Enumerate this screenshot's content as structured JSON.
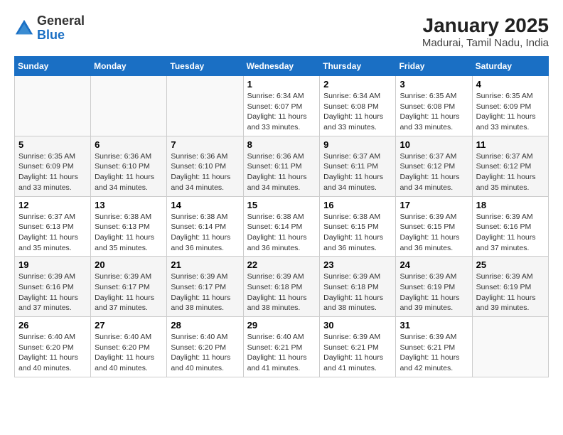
{
  "header": {
    "logo_general": "General",
    "logo_blue": "Blue",
    "title": "January 2025",
    "subtitle": "Madurai, Tamil Nadu, India"
  },
  "calendar": {
    "days_of_week": [
      "Sunday",
      "Monday",
      "Tuesday",
      "Wednesday",
      "Thursday",
      "Friday",
      "Saturday"
    ],
    "weeks": [
      [
        {
          "day": "",
          "info": ""
        },
        {
          "day": "",
          "info": ""
        },
        {
          "day": "",
          "info": ""
        },
        {
          "day": "1",
          "info": "Sunrise: 6:34 AM\nSunset: 6:07 PM\nDaylight: 11 hours\nand 33 minutes."
        },
        {
          "day": "2",
          "info": "Sunrise: 6:34 AM\nSunset: 6:08 PM\nDaylight: 11 hours\nand 33 minutes."
        },
        {
          "day": "3",
          "info": "Sunrise: 6:35 AM\nSunset: 6:08 PM\nDaylight: 11 hours\nand 33 minutes."
        },
        {
          "day": "4",
          "info": "Sunrise: 6:35 AM\nSunset: 6:09 PM\nDaylight: 11 hours\nand 33 minutes."
        }
      ],
      [
        {
          "day": "5",
          "info": "Sunrise: 6:35 AM\nSunset: 6:09 PM\nDaylight: 11 hours\nand 33 minutes."
        },
        {
          "day": "6",
          "info": "Sunrise: 6:36 AM\nSunset: 6:10 PM\nDaylight: 11 hours\nand 34 minutes."
        },
        {
          "day": "7",
          "info": "Sunrise: 6:36 AM\nSunset: 6:10 PM\nDaylight: 11 hours\nand 34 minutes."
        },
        {
          "day": "8",
          "info": "Sunrise: 6:36 AM\nSunset: 6:11 PM\nDaylight: 11 hours\nand 34 minutes."
        },
        {
          "day": "9",
          "info": "Sunrise: 6:37 AM\nSunset: 6:11 PM\nDaylight: 11 hours\nand 34 minutes."
        },
        {
          "day": "10",
          "info": "Sunrise: 6:37 AM\nSunset: 6:12 PM\nDaylight: 11 hours\nand 34 minutes."
        },
        {
          "day": "11",
          "info": "Sunrise: 6:37 AM\nSunset: 6:12 PM\nDaylight: 11 hours\nand 35 minutes."
        }
      ],
      [
        {
          "day": "12",
          "info": "Sunrise: 6:37 AM\nSunset: 6:13 PM\nDaylight: 11 hours\nand 35 minutes."
        },
        {
          "day": "13",
          "info": "Sunrise: 6:38 AM\nSunset: 6:13 PM\nDaylight: 11 hours\nand 35 minutes."
        },
        {
          "day": "14",
          "info": "Sunrise: 6:38 AM\nSunset: 6:14 PM\nDaylight: 11 hours\nand 36 minutes."
        },
        {
          "day": "15",
          "info": "Sunrise: 6:38 AM\nSunset: 6:14 PM\nDaylight: 11 hours\nand 36 minutes."
        },
        {
          "day": "16",
          "info": "Sunrise: 6:38 AM\nSunset: 6:15 PM\nDaylight: 11 hours\nand 36 minutes."
        },
        {
          "day": "17",
          "info": "Sunrise: 6:39 AM\nSunset: 6:15 PM\nDaylight: 11 hours\nand 36 minutes."
        },
        {
          "day": "18",
          "info": "Sunrise: 6:39 AM\nSunset: 6:16 PM\nDaylight: 11 hours\nand 37 minutes."
        }
      ],
      [
        {
          "day": "19",
          "info": "Sunrise: 6:39 AM\nSunset: 6:16 PM\nDaylight: 11 hours\nand 37 minutes."
        },
        {
          "day": "20",
          "info": "Sunrise: 6:39 AM\nSunset: 6:17 PM\nDaylight: 11 hours\nand 37 minutes."
        },
        {
          "day": "21",
          "info": "Sunrise: 6:39 AM\nSunset: 6:17 PM\nDaylight: 11 hours\nand 38 minutes."
        },
        {
          "day": "22",
          "info": "Sunrise: 6:39 AM\nSunset: 6:18 PM\nDaylight: 11 hours\nand 38 minutes."
        },
        {
          "day": "23",
          "info": "Sunrise: 6:39 AM\nSunset: 6:18 PM\nDaylight: 11 hours\nand 38 minutes."
        },
        {
          "day": "24",
          "info": "Sunrise: 6:39 AM\nSunset: 6:19 PM\nDaylight: 11 hours\nand 39 minutes."
        },
        {
          "day": "25",
          "info": "Sunrise: 6:39 AM\nSunset: 6:19 PM\nDaylight: 11 hours\nand 39 minutes."
        }
      ],
      [
        {
          "day": "26",
          "info": "Sunrise: 6:40 AM\nSunset: 6:20 PM\nDaylight: 11 hours\nand 40 minutes."
        },
        {
          "day": "27",
          "info": "Sunrise: 6:40 AM\nSunset: 6:20 PM\nDaylight: 11 hours\nand 40 minutes."
        },
        {
          "day": "28",
          "info": "Sunrise: 6:40 AM\nSunset: 6:20 PM\nDaylight: 11 hours\nand 40 minutes."
        },
        {
          "day": "29",
          "info": "Sunrise: 6:40 AM\nSunset: 6:21 PM\nDaylight: 11 hours\nand 41 minutes."
        },
        {
          "day": "30",
          "info": "Sunrise: 6:39 AM\nSunset: 6:21 PM\nDaylight: 11 hours\nand 41 minutes."
        },
        {
          "day": "31",
          "info": "Sunrise: 6:39 AM\nSunset: 6:21 PM\nDaylight: 11 hours\nand 42 minutes."
        },
        {
          "day": "",
          "info": ""
        }
      ]
    ]
  }
}
